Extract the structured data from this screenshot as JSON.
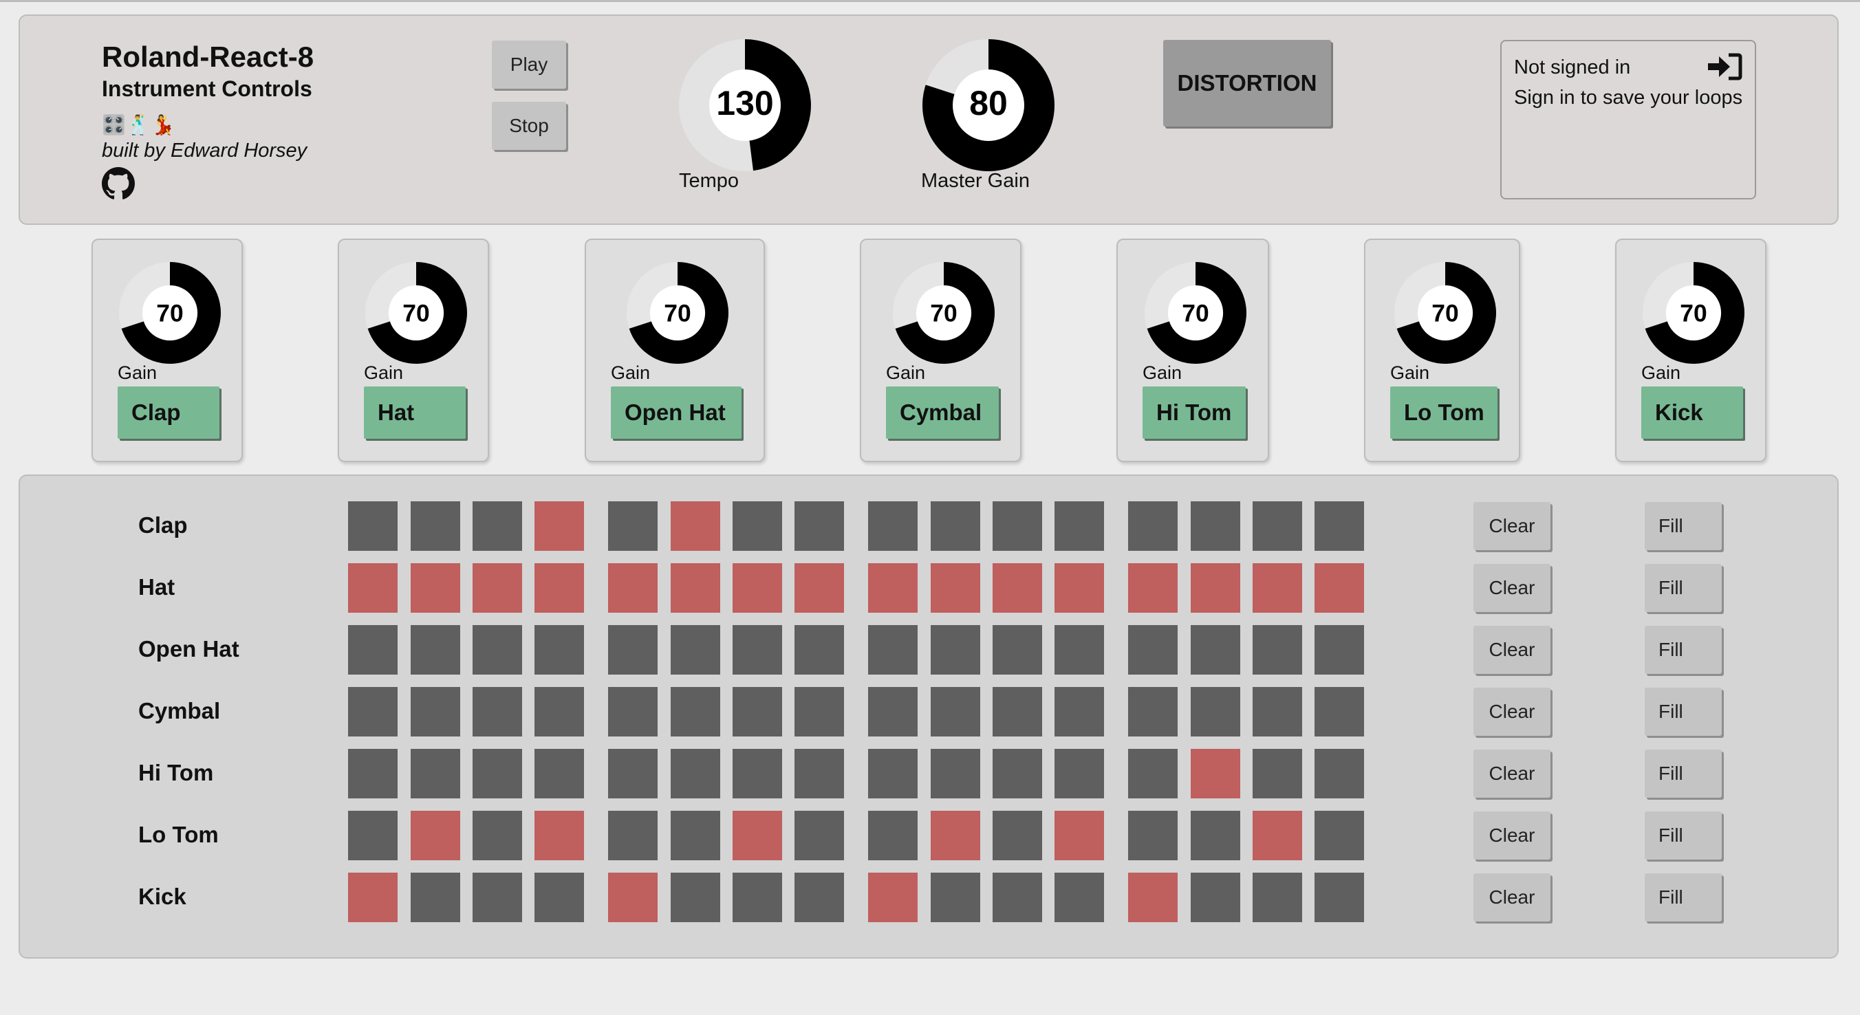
{
  "app": {
    "title": "Roland-React-8",
    "subtitle": "Instrument Controls",
    "emojis": "🎛️🕺💃",
    "credit": "built by Edward Horsey",
    "github_icon": "github-icon"
  },
  "transport": {
    "play_label": "Play",
    "stop_label": "Stop"
  },
  "tempo": {
    "value": "130",
    "label": "Tempo",
    "level": 0.48
  },
  "master_gain": {
    "value": "80",
    "label": "Master Gain",
    "level": 0.8
  },
  "effects": {
    "distortion_label": "DISTORTION"
  },
  "auth": {
    "status": "Not signed in",
    "prompt": "Sign in to save your loops",
    "icon": "sign-in-icon"
  },
  "instruments": [
    {
      "name": "Clap",
      "gain_label": "Gain",
      "gain": "70",
      "level": 0.7
    },
    {
      "name": "Hat",
      "gain_label": "Gain",
      "gain": "70",
      "level": 0.7
    },
    {
      "name": "Open Hat",
      "gain_label": "Gain",
      "gain": "70",
      "level": 0.7
    },
    {
      "name": "Cymbal",
      "gain_label": "Gain",
      "gain": "70",
      "level": 0.7
    },
    {
      "name": "Hi Tom",
      "gain_label": "Gain",
      "gain": "70",
      "level": 0.7
    },
    {
      "name": "Lo Tom",
      "gain_label": "Gain",
      "gain": "70",
      "level": 0.7
    },
    {
      "name": "Kick",
      "gain_label": "Gain",
      "gain": "70",
      "level": 0.7
    }
  ],
  "sequencer": {
    "clear_label": "Clear",
    "fill_label": "Fill",
    "colors": {
      "active": "#bf5f5e",
      "inactive": "#5f5f5f"
    },
    "rows": [
      {
        "name": "Clap",
        "steps": [
          0,
          0,
          0,
          1,
          0,
          1,
          0,
          0,
          0,
          0,
          0,
          0,
          0,
          0,
          0,
          0
        ]
      },
      {
        "name": "Hat",
        "steps": [
          1,
          1,
          1,
          1,
          1,
          1,
          1,
          1,
          1,
          1,
          1,
          1,
          1,
          1,
          1,
          1
        ]
      },
      {
        "name": "Open Hat",
        "steps": [
          0,
          0,
          0,
          0,
          0,
          0,
          0,
          0,
          0,
          0,
          0,
          0,
          0,
          0,
          0,
          0
        ]
      },
      {
        "name": "Cymbal",
        "steps": [
          0,
          0,
          0,
          0,
          0,
          0,
          0,
          0,
          0,
          0,
          0,
          0,
          0,
          0,
          0,
          0
        ]
      },
      {
        "name": "Hi Tom",
        "steps": [
          0,
          0,
          0,
          0,
          0,
          0,
          0,
          0,
          0,
          0,
          0,
          0,
          0,
          1,
          0,
          0
        ]
      },
      {
        "name": "Lo Tom",
        "steps": [
          0,
          1,
          0,
          1,
          0,
          0,
          1,
          0,
          0,
          1,
          0,
          1,
          0,
          0,
          1,
          0
        ]
      },
      {
        "name": "Kick",
        "steps": [
          1,
          0,
          0,
          0,
          1,
          0,
          0,
          0,
          1,
          0,
          0,
          0,
          1,
          0,
          0,
          0
        ]
      }
    ]
  }
}
